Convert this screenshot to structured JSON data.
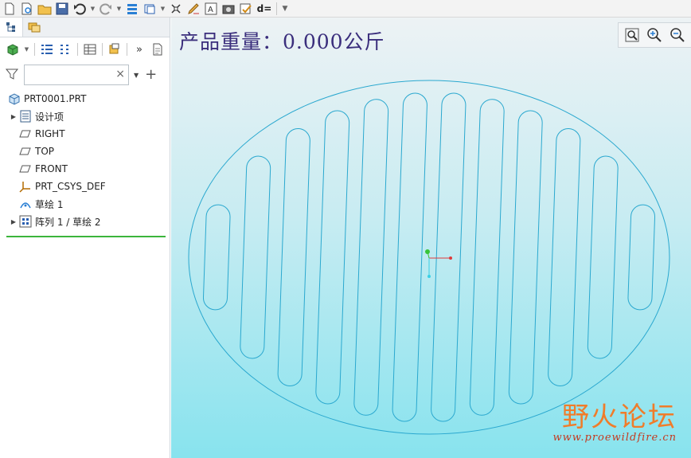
{
  "toolbar": {
    "buttons": [
      "new-icon",
      "open-icon",
      "folder-icon",
      "save-icon",
      "undo-icon",
      "redo-icon",
      "regenerate-icon",
      "window-icon",
      "close-window-icon",
      "edit-icon",
      "annotation-icon",
      "screenshot-icon",
      "verify-icon",
      "d-equals-icon",
      "more-icon"
    ],
    "d_label": "d="
  },
  "sidebar": {
    "filter_placeholder": "",
    "tree": [
      {
        "label": "PRT0001.PRT",
        "icon": "part-icon",
        "expandable": false
      },
      {
        "label": "设计项",
        "icon": "design-items-icon",
        "expandable": true
      },
      {
        "label": "RIGHT",
        "icon": "datum-plane-icon",
        "expandable": false
      },
      {
        "label": "TOP",
        "icon": "datum-plane-icon",
        "expandable": false
      },
      {
        "label": "FRONT",
        "icon": "datum-plane-icon",
        "expandable": false
      },
      {
        "label": "PRT_CSYS_DEF",
        "icon": "csys-icon",
        "expandable": false
      },
      {
        "label": "草绘 1",
        "icon": "sketch-icon",
        "expandable": false
      },
      {
        "label": "阵列 1 / 草绘 2",
        "icon": "pattern-icon",
        "expandable": true
      }
    ]
  },
  "viewport": {
    "mass_label": "产品重量：0.000公斤",
    "zoom_buttons": [
      "refit-icon",
      "zoom-in-icon",
      "zoom-out-icon"
    ]
  },
  "watermark": {
    "title": "野火论坛",
    "url": "www.proewildfire.cn"
  },
  "colors": {
    "sketch_line": "#2aa8cf",
    "mass_text": "#3a2e7c",
    "watermark": "#f07c2a"
  }
}
